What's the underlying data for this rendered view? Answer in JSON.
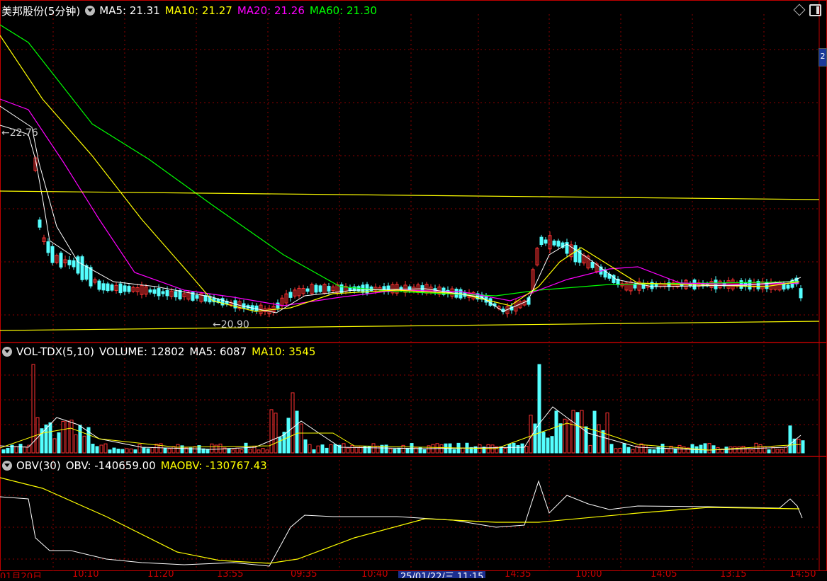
{
  "main_header": {
    "title": "美邦股份(5分钟)",
    "ma5": "MA5: 21.31",
    "ma10": "MA10: 21.27",
    "ma20": "MA20: 21.26",
    "ma60": "MA60: 21.30"
  },
  "price_labels": {
    "high": "22.76",
    "low": "20.90"
  },
  "volume_header": {
    "title": "VOL-TDX(5,10)",
    "volume": "VOLUME: 12802",
    "ma5": "MA5: 6087",
    "ma10": "MA10: 3545"
  },
  "obv_header": {
    "title": "OBV(30)",
    "obv": "OBV: -140659.00",
    "maobv": "MAOBV: -130767.43"
  },
  "right_axis_badge": "2",
  "time_axis": [
    "01月20日",
    "10:10",
    "11:20",
    "13:55",
    "09:35",
    "10:40",
    "11:15",
    "14:35",
    "10:00",
    "14:05",
    "13:15",
    "14:50"
  ],
  "time_cursor": "25/01/22/三 11:15",
  "colors": {
    "up": "#ff3232",
    "down": "#54ffff",
    "ma5": "#ffffff",
    "ma10": "#ffff00",
    "ma20": "#ff00ff",
    "ma60": "#00ff00",
    "grid": "#8b0000",
    "border": "#c00000"
  },
  "chart_data": {
    "type": "candlestick",
    "series_names": [
      "MA5",
      "MA10",
      "MA20",
      "MA60"
    ],
    "price_range": [
      20.9,
      22.76
    ],
    "volume_last": 12802,
    "obv_last": -140659.0,
    "maobv_last": -130767.43
  }
}
